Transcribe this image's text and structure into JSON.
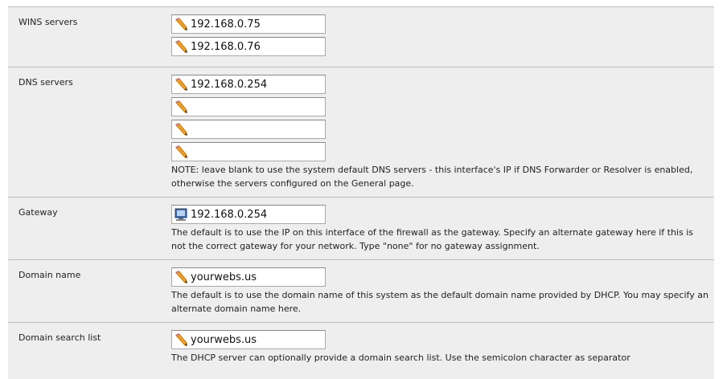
{
  "wins": {
    "label": "WINS servers",
    "values": [
      "192.168.0.75",
      "192.168.0.76"
    ]
  },
  "dns": {
    "label": "DNS servers",
    "values": [
      "192.168.0.254",
      "",
      "",
      ""
    ],
    "note": "NOTE: leave blank to use the system default DNS servers - this interface's IP if DNS Forwarder or Resolver is enabled, otherwise the servers configured on the General page."
  },
  "gateway": {
    "label": "Gateway",
    "value": "192.168.0.254",
    "note": "The default is to use the IP on this interface of the firewall as the gateway. Specify an alternate gateway here if this is not the correct gateway for your network. Type \"none\" for no gateway assignment."
  },
  "domain_name": {
    "label": "Domain name",
    "value": "yourwebs.us",
    "note": "The default is to use the domain name of this system as the default domain name provided by DHCP. You may specify an alternate domain name here."
  },
  "domain_search": {
    "label": "Domain search list",
    "value": "yourwebs.us",
    "note": "The DHCP server can optionally provide a domain search list. Use the semicolon character as separator"
  },
  "icons": {
    "edit": "pencil-icon",
    "gateway": "network-icon"
  },
  "colors": {
    "panel_bg": "#eeeeee",
    "divider": "#bdbdbd",
    "input_border": "#a9a9a9"
  }
}
